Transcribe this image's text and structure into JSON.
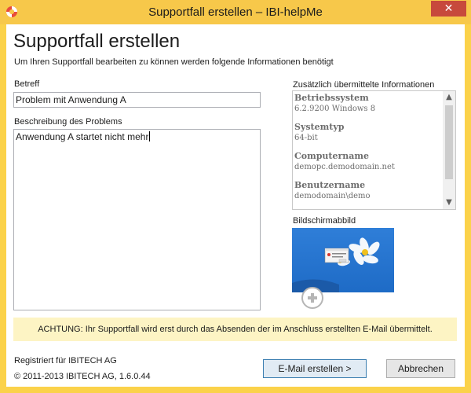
{
  "window": {
    "title": "Supportfall erstellen – IBI-helpMe",
    "close_glyph": "✕",
    "icon": "lifebuoy-icon"
  },
  "header": {
    "title": "Supportfall erstellen",
    "subtitle": "Um Ihren Supportfall bearbeiten zu können werden folgende Informationen benötigt"
  },
  "form": {
    "subject_label": "Betreff",
    "subject_value": "Problem mit Anwendung A",
    "description_label": "Beschreibung des Problems",
    "description_value": "Anwendung A startet nicht mehr"
  },
  "info": {
    "label": "Zusätzlich übermittelte Informationen",
    "items": [
      {
        "key": "Betriebssystem",
        "value": "6.2.9200 Windows 8"
      },
      {
        "key": "Systemtyp",
        "value": "64-bit"
      },
      {
        "key": "Computername",
        "value": "demopc.demodomain.net"
      },
      {
        "key": "Benutzername",
        "value": "demodomain\\demo"
      }
    ],
    "scroll_up_glyph": "▲",
    "scroll_down_glyph": "▼"
  },
  "screenshot": {
    "label": "Bildschirmabbild",
    "add_icon": "plus-circle-icon"
  },
  "warning": "ACHTUNG: Ihr Supportfall wird erst durch das Absenden der im Anschluss erstellten E-Mail übermittelt.",
  "footer": {
    "registered": "Registriert für IBITECH AG",
    "copyright": "© 2011-2013 IBITECH AG, 1.6.0.44",
    "create_email_button": "E-Mail erstellen >",
    "cancel_button": "Abbrechen"
  },
  "colors": {
    "titlebar": "#f7c84a",
    "close": "#c7493c",
    "warning_bg": "#fdf4c4",
    "primary_border": "#3c7fb1"
  }
}
